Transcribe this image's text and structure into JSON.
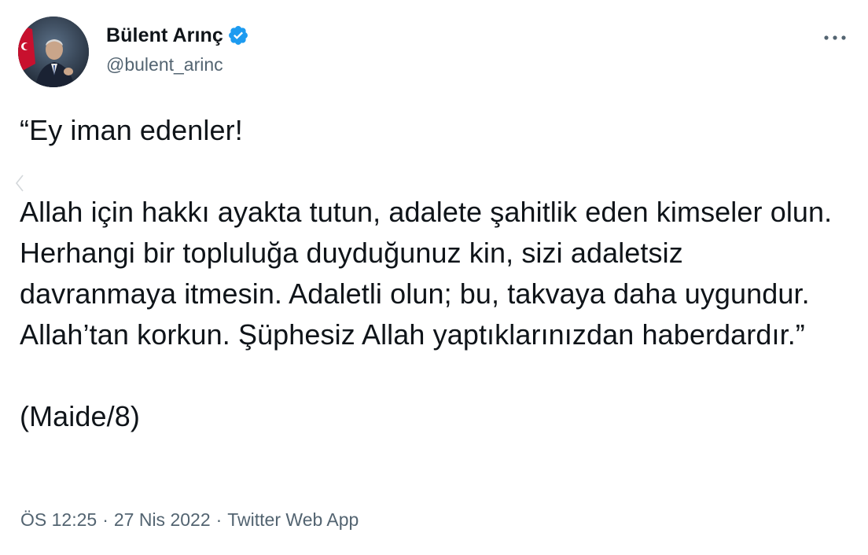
{
  "author": {
    "display_name": "Bülent Arınç",
    "handle": "@bulent_arinc",
    "verified": true,
    "verified_color": "#1d9bf0"
  },
  "tweet": {
    "text": "“Ey iman edenler!\n\nAllah için hakkı ayakta tutun, adalete şahitlik eden kimseler olun. Herhangi bir topluluğa duyduğunuz kin, sizi adaletsiz davranmaya itmesin. Adaletli olun; bu, takvaya daha uygundur. Allah’tan korkun. Şüphesiz Allah yaptıklarınızdan haberdardır.”\n\n(Maide/8)"
  },
  "meta": {
    "time": "ÖS 12:25",
    "date": "27 Nis 2022",
    "source": "Twitter Web App",
    "separator": "·"
  },
  "icons": {
    "more": "more-horizontal-icon",
    "verified": "verified-badge-icon",
    "back": "chevron-left-icon"
  },
  "colors": {
    "text_primary": "#0f1419",
    "text_secondary": "#536471",
    "background": "#ffffff"
  }
}
